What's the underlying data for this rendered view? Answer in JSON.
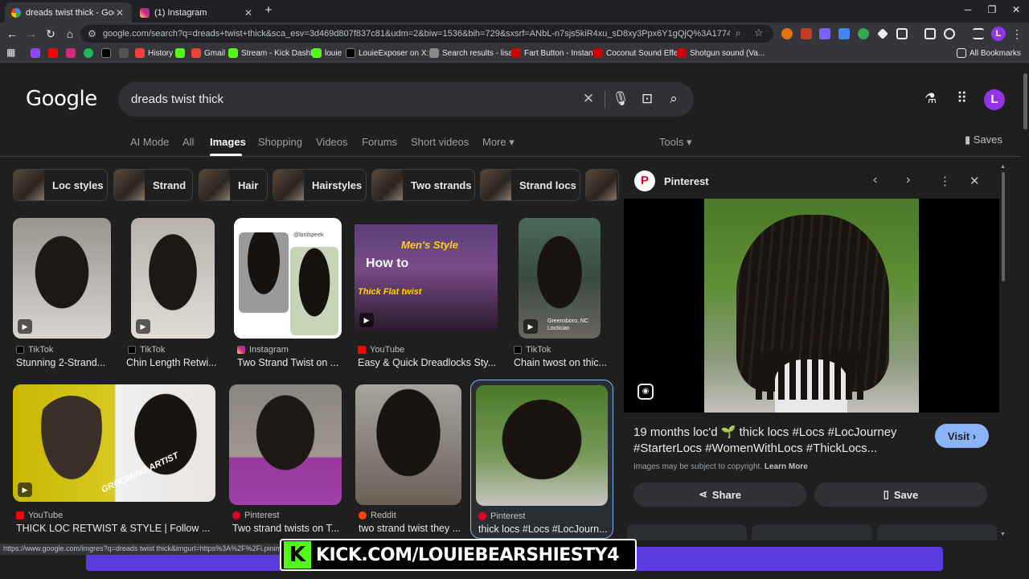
{
  "browser": {
    "tabs": [
      {
        "title": "dreads twist thick - Google Se...",
        "active": true
      },
      {
        "title": "(1) Instagram",
        "active": false
      }
    ],
    "url": "google.com/search?q=dreads+twist+thick&sca_esv=3d469d807f837c81&udm=2&biw=1536&bih=729&sxsrf=ANbL-n7sjs5kiR4xu_sD8xy3Ppx6Y1gQjQ%3A1774807321481&ei=GWnJaY2F...",
    "profile_initial": "L",
    "bookmarks": [
      "History",
      "Gmail",
      "Stream - Kick Dashb...",
      "louie",
      "LouieExposer on X:...",
      "Search results - lisar...",
      "Fart Button - Instant...",
      "Coconut Sound Effe...",
      "Shotgun sound (Va..."
    ],
    "all_bookmarks": "All Bookmarks",
    "status_url": "https://www.google.com/imgres?q=dreads twist thick&imgurl=https%3A%2F%2Fi.pinimg.com%2"
  },
  "search": {
    "logo": "Google",
    "query": "dreads twist thick",
    "tabs": [
      "AI Mode",
      "All",
      "Images",
      "Shopping",
      "Videos",
      "Forums",
      "Short videos",
      "More"
    ],
    "active_tab": "Images",
    "tools": "Tools",
    "saves": "Saves",
    "chips": [
      "Loc styles",
      "Strand",
      "Hair",
      "Hairstyles",
      "Two strands",
      "Strand locs"
    ]
  },
  "results": [
    {
      "source": "TikTok",
      "title": "Stunning 2-Strand..."
    },
    {
      "source": "TikTok",
      "title": "Chin Length Retwi..."
    },
    {
      "source": "Instagram",
      "title": "Two Strand Twist on ..."
    },
    {
      "source": "YouTube",
      "title": "Easy & Quick Dreadlocks Sty..."
    },
    {
      "source": "TikTok",
      "title": "Chain twost on thic..."
    },
    {
      "source": "YouTube",
      "title": "THICK LOC RETWIST & STYLE | Follow ..."
    },
    {
      "source": "Pinterest",
      "title": "Two strand twists on T..."
    },
    {
      "source": "Reddit",
      "title": "two strand twist they ..."
    },
    {
      "source": "Pinterest",
      "title": "thick locs #Locs #LocJourn..."
    }
  ],
  "thumb_text": {
    "yt_overlay_1": "Men's Style",
    "yt_overlay_2": "How to",
    "yt_overlay_3": "Thick Flat twist",
    "tiktok_loc": "Greensboro, NC\nLoctician",
    "watermark": "GROOMING ARTIST",
    "handle": "@lordspeek"
  },
  "panel": {
    "source": "Pinterest",
    "title": "19 months loc'd 🌱 thick locs #Locs #LocJourney #StarterLocs #WomenWithLocs #ThickLocs...",
    "visit": "Visit",
    "copyright": "Images may be subject to copyright.",
    "learn_more": "Learn More",
    "share": "Share",
    "save": "Save"
  },
  "overlay": {
    "kick_text": "KICK.COM/LOUIEBEARSHIESTY4"
  },
  "colors": {
    "page_bg": "#1f1f1f",
    "accent_blue": "#8ab4f8",
    "kick_green": "#53fc18",
    "profile_purple": "#9334e6",
    "stream_bar": "#5b3ae0"
  }
}
